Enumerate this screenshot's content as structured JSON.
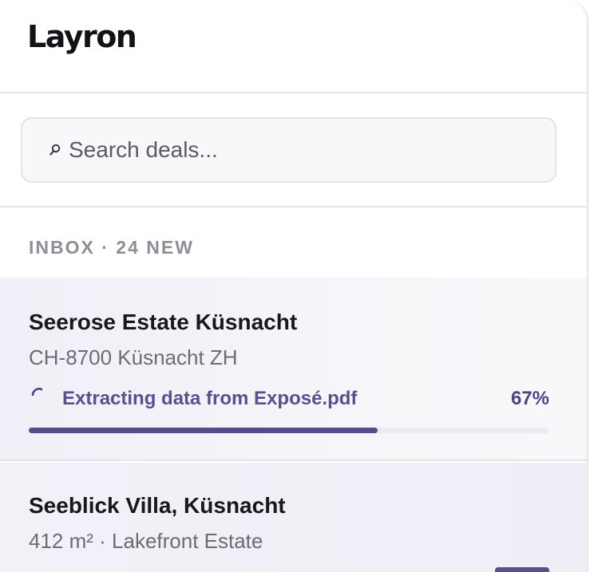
{
  "app": {
    "logo_text": "Layron"
  },
  "search": {
    "placeholder": "Search deals..."
  },
  "inbox": {
    "label": "INBOX · 24 NEW"
  },
  "deals": [
    {
      "title": "Seerose Estate Küsnacht",
      "subtitle": "CH-8700 Küsnacht ZH",
      "status_text": "Extracting data from Exposé.pdf",
      "progress_label": "67%",
      "progress_value": 0.67
    },
    {
      "title": "Seeblick Villa, Küsnacht",
      "subtitle": "412 m² · Lakefront Estate"
    }
  ],
  "icons": {
    "search": "search-icon",
    "spinner": "loading-spinner-icon"
  },
  "colors": {
    "accent": "#574b8a",
    "accent_text": "#5b4f8e",
    "selected_row_bg": "#f1eff7"
  }
}
